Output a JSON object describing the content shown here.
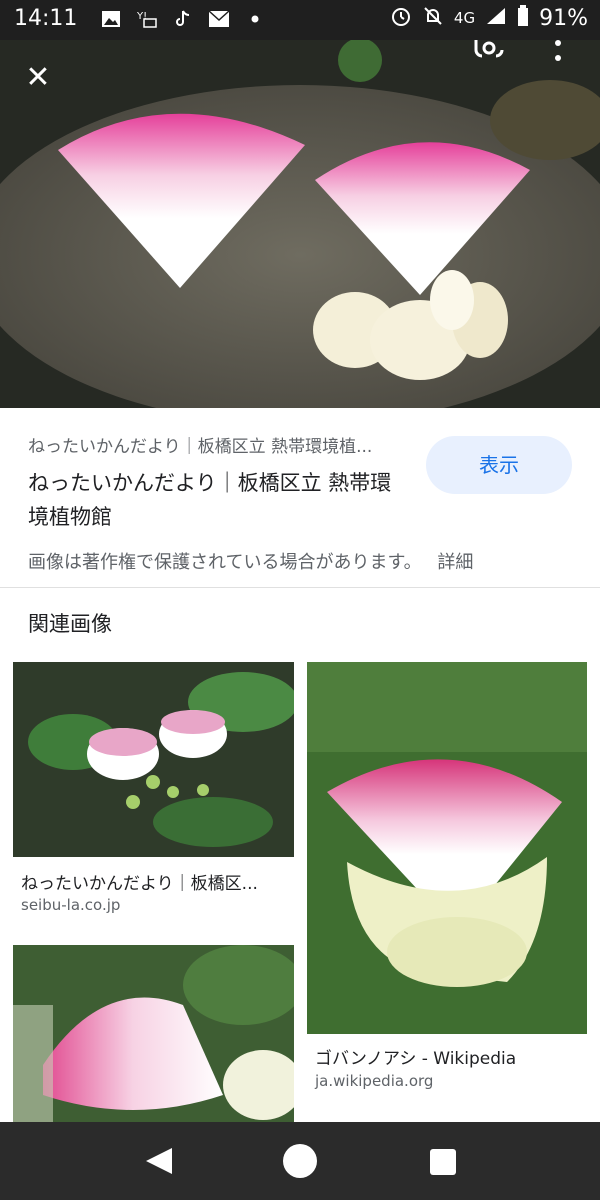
{
  "status_bar": {
    "time": "14:11",
    "network": "4G",
    "battery": "91%",
    "icons_left": [
      "image-icon",
      "yahoo-mail-icon",
      "tiktok-icon",
      "au-mail-icon",
      "dot-icon"
    ],
    "icons_right": [
      "alarm-icon",
      "mute-icon",
      "signal-icon",
      "battery-icon"
    ]
  },
  "header": {
    "close_label": "✕"
  },
  "result": {
    "source": "ねったいかんだより｜板橋区立 熱帯環境植...",
    "title": "ねったいかんだより｜板橋区立 熱帯環境植物館",
    "view_button": "表示",
    "copyright_notice": "画像は著作権で保護されている場合があります。",
    "detail_link": "詳細"
  },
  "related": {
    "heading": "関連画像",
    "items": [
      {
        "title": "ねったいかんだより｜板橋区...",
        "domain": "seibu-la.co.jp"
      },
      {
        "title": "ゴバンノアシ - Wikipedia",
        "domain": "ja.wikipedia.org"
      },
      {
        "title": "",
        "domain": ""
      }
    ]
  },
  "colors": {
    "accent": "#1a73e8",
    "button_bg": "#e8f0fe",
    "flower_pink": "#d6357a",
    "status_bar": "#1f1f1f",
    "nav_bar": "#2b2b2b"
  }
}
